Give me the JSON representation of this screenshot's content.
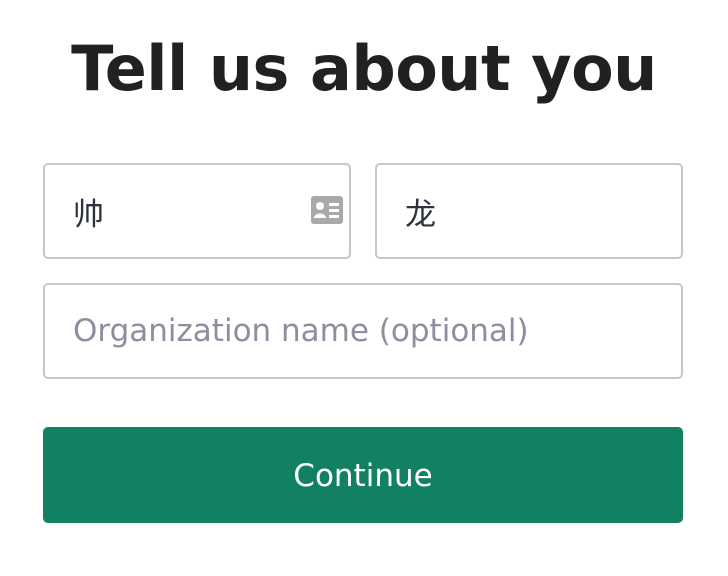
{
  "page": {
    "title": "Tell us about you"
  },
  "form": {
    "first_name": {
      "value": "帅",
      "placeholder": ""
    },
    "last_name": {
      "value": "龙",
      "placeholder": ""
    },
    "organization": {
      "value": "",
      "placeholder": "Organization name (optional)"
    },
    "continue_label": "Continue"
  },
  "icons": {
    "autofill": "contact-card-icon"
  },
  "colors": {
    "accent": "#128063",
    "border": "#c2c8d0",
    "title": "#202123",
    "placeholder": "#8e8ea0"
  }
}
